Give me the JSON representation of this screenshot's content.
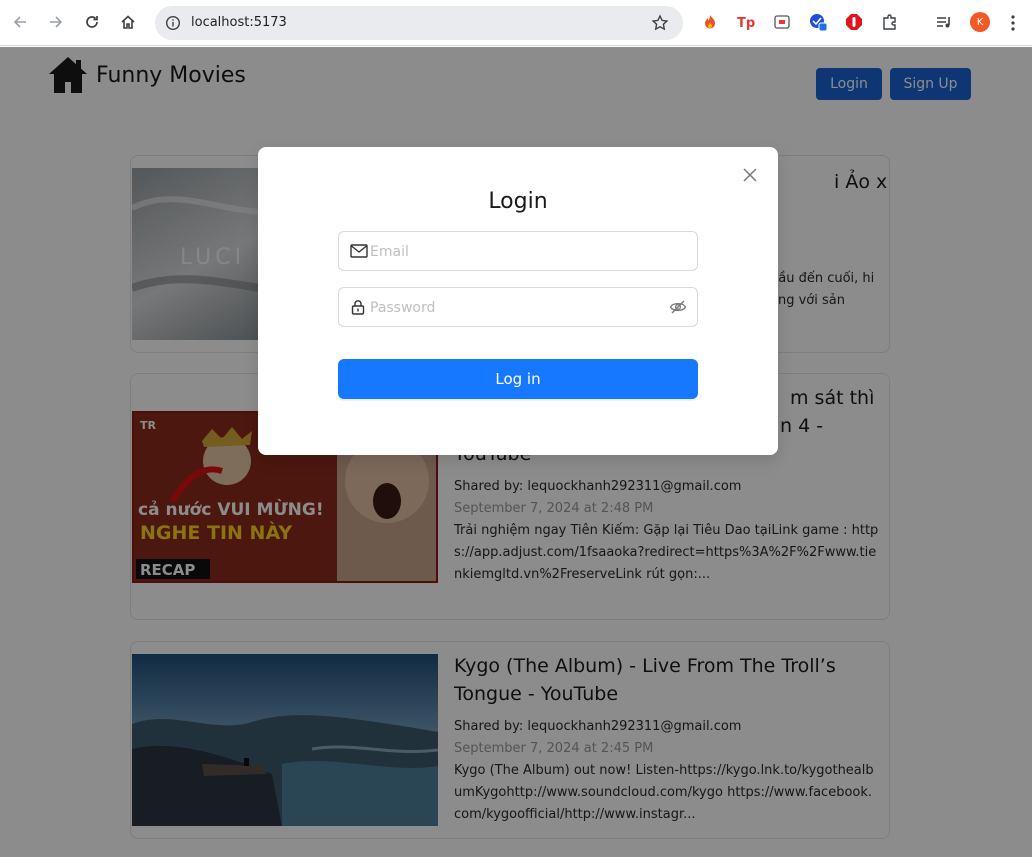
{
  "browser": {
    "url": "localhost:5173",
    "profile_initial": "K"
  },
  "header": {
    "logo_text": "Funny Movies",
    "login_label": "Login",
    "signup_label": "Sign Up"
  },
  "videos": [
    {
      "title_visible": "i Ảo x Nhà",
      "desc_line1": "đầu đến cuối, hi",
      "desc_line2": "àng với sản",
      "thumb_text": "LUCI"
    },
    {
      "title_line1": "m sát thì",
      "title_line2": "n 4 -",
      "title_line3": "YouTube",
      "shared": "Shared by: lequockhanh292311@gmail.com",
      "date": "September 7, 2024 at 2:48 PM",
      "desc": "Trải nghiệm ngay Tiên Kiếm: Gặp lại Tiêu Dao tạiLink game : https://app.adjust.com/1fsaaoka?redirect=https%3A%2F%2Fwww.tienkiemgltd.vn%2FreserveLink rút gọn:...",
      "thumb_caption_top": "cả nước VUI MỪNG!",
      "thumb_caption_bottom": "NGHE TIN NÀY",
      "thumb_badge": "RECAP",
      "thumb_logo": "TR"
    },
    {
      "title_line1": "Kygo (The Album) - Live From The Troll’s",
      "title_line2": "Tongue - YouTube",
      "shared": "Shared by: lequockhanh292311@gmail.com",
      "date": "September 7, 2024 at 2:45 PM",
      "desc": "Kygo (The Album) out now! Listen-https://kygo.lnk.to/kygothealbumKygohttp://www.soundcloud.com/kygo https://www.facebook.com/kygoofficial/http://www.instagr..."
    }
  ],
  "modal": {
    "title": "Login",
    "email_placeholder": "Email",
    "password_placeholder": "Password",
    "submit_label": "Log in"
  },
  "colors": {
    "primary": "#1677ff",
    "header_button": "#1b63d6",
    "overlay": "rgba(0,0,0,0.45)"
  }
}
